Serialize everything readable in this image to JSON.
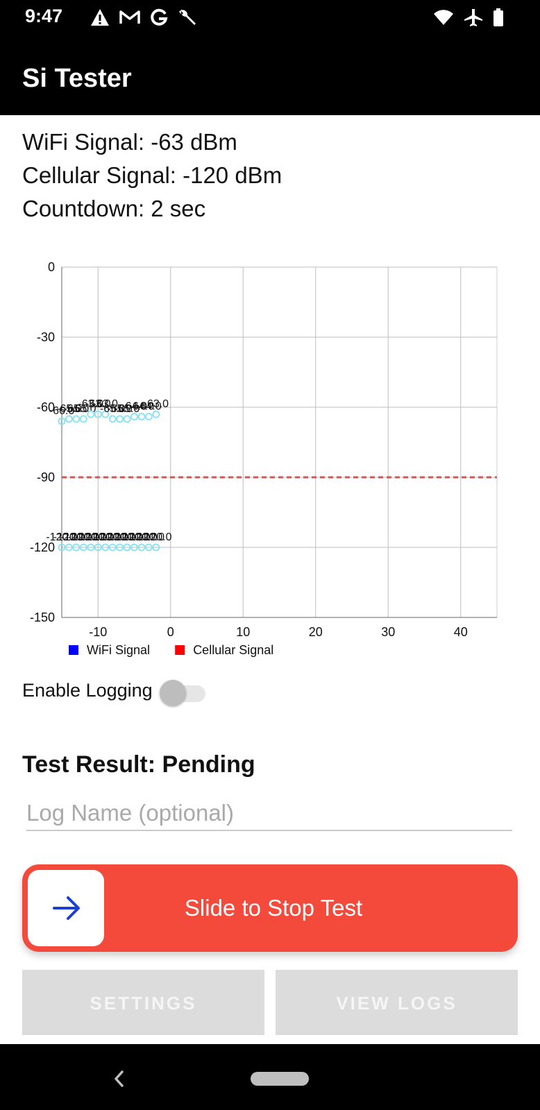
{
  "status_bar": {
    "time": "9:47",
    "left_icons": [
      "warning-icon",
      "gmail-icon",
      "google-icon",
      "wrench-icon"
    ],
    "right_icons": [
      "wifi-icon",
      "airplane-icon",
      "battery-icon"
    ]
  },
  "app": {
    "title": "Si Tester"
  },
  "info": {
    "wifi": "WiFi Signal: -63 dBm",
    "cellular": "Cellular Signal: -120 dBm",
    "countdown": "Countdown: 2 sec"
  },
  "chart_data": {
    "type": "line",
    "xlim": [
      -15,
      45
    ],
    "ylim": [
      -150,
      0
    ],
    "x_ticks": [
      -10,
      0,
      10,
      20,
      30,
      40
    ],
    "y_ticks": [
      0,
      -30,
      -60,
      -90,
      -120,
      -150
    ],
    "grid": true,
    "threshold_line": {
      "value": -90,
      "color": "#d9534f",
      "style": "dashed"
    },
    "series": [
      {
        "name": "WiFi Signal",
        "legend_color": "#0000ff",
        "marker_color": "#8ee3f2",
        "x": [
          -15,
          -14,
          -13,
          -12,
          -11,
          -10,
          -9,
          -8,
          -7,
          -6,
          -5,
          -4,
          -3,
          -2
        ],
        "y": [
          -66,
          -65,
          -65,
          -65,
          -63,
          -63,
          -63,
          -65,
          -65,
          -65,
          -64,
          -64,
          -64,
          -63
        ],
        "labels": [
          "-66.0",
          "-65.0",
          "-65.0",
          "-65.0",
          "-63.0",
          "-63.0",
          "-63.0",
          "-65.0",
          "-65.0",
          "-65.0",
          "-64.0",
          "-64.0",
          "-64.0",
          "-63.0"
        ]
      },
      {
        "name": "Cellular Signal",
        "legend_color": "#ff0000",
        "marker_color": "#8ee3f2",
        "x": [
          -15,
          -14,
          -13,
          -12,
          -11,
          -10,
          -9,
          -8,
          -7,
          -6,
          -5,
          -4,
          -3,
          -2
        ],
        "y": [
          -120,
          -120,
          -120,
          -120,
          -120,
          -120,
          -120,
          -120,
          -120,
          -120,
          -120,
          -120,
          -120,
          -120
        ],
        "labels": [
          "-120.0",
          "-120.0",
          "-120.0",
          "-120.0",
          "-120.0",
          "-120.0",
          "-120.0",
          "-120.0",
          "-120.0",
          "-120.0",
          "-120.0",
          "-120.0",
          "-120.0",
          "-120.0"
        ]
      }
    ]
  },
  "logging": {
    "label": "Enable Logging",
    "enabled": false
  },
  "result": {
    "text": "Test Result: Pending"
  },
  "log_name": {
    "placeholder": "Log Name (optional)",
    "value": ""
  },
  "slider": {
    "label": "Slide to Stop Test",
    "color": "#f44a3b",
    "icon": "arrow-right-icon"
  },
  "buttons": {
    "settings": "SETTINGS",
    "view_logs": "VIEW LOGS"
  },
  "nav": {
    "back_icon": "back-icon",
    "home_icon": "home-pill-icon"
  }
}
